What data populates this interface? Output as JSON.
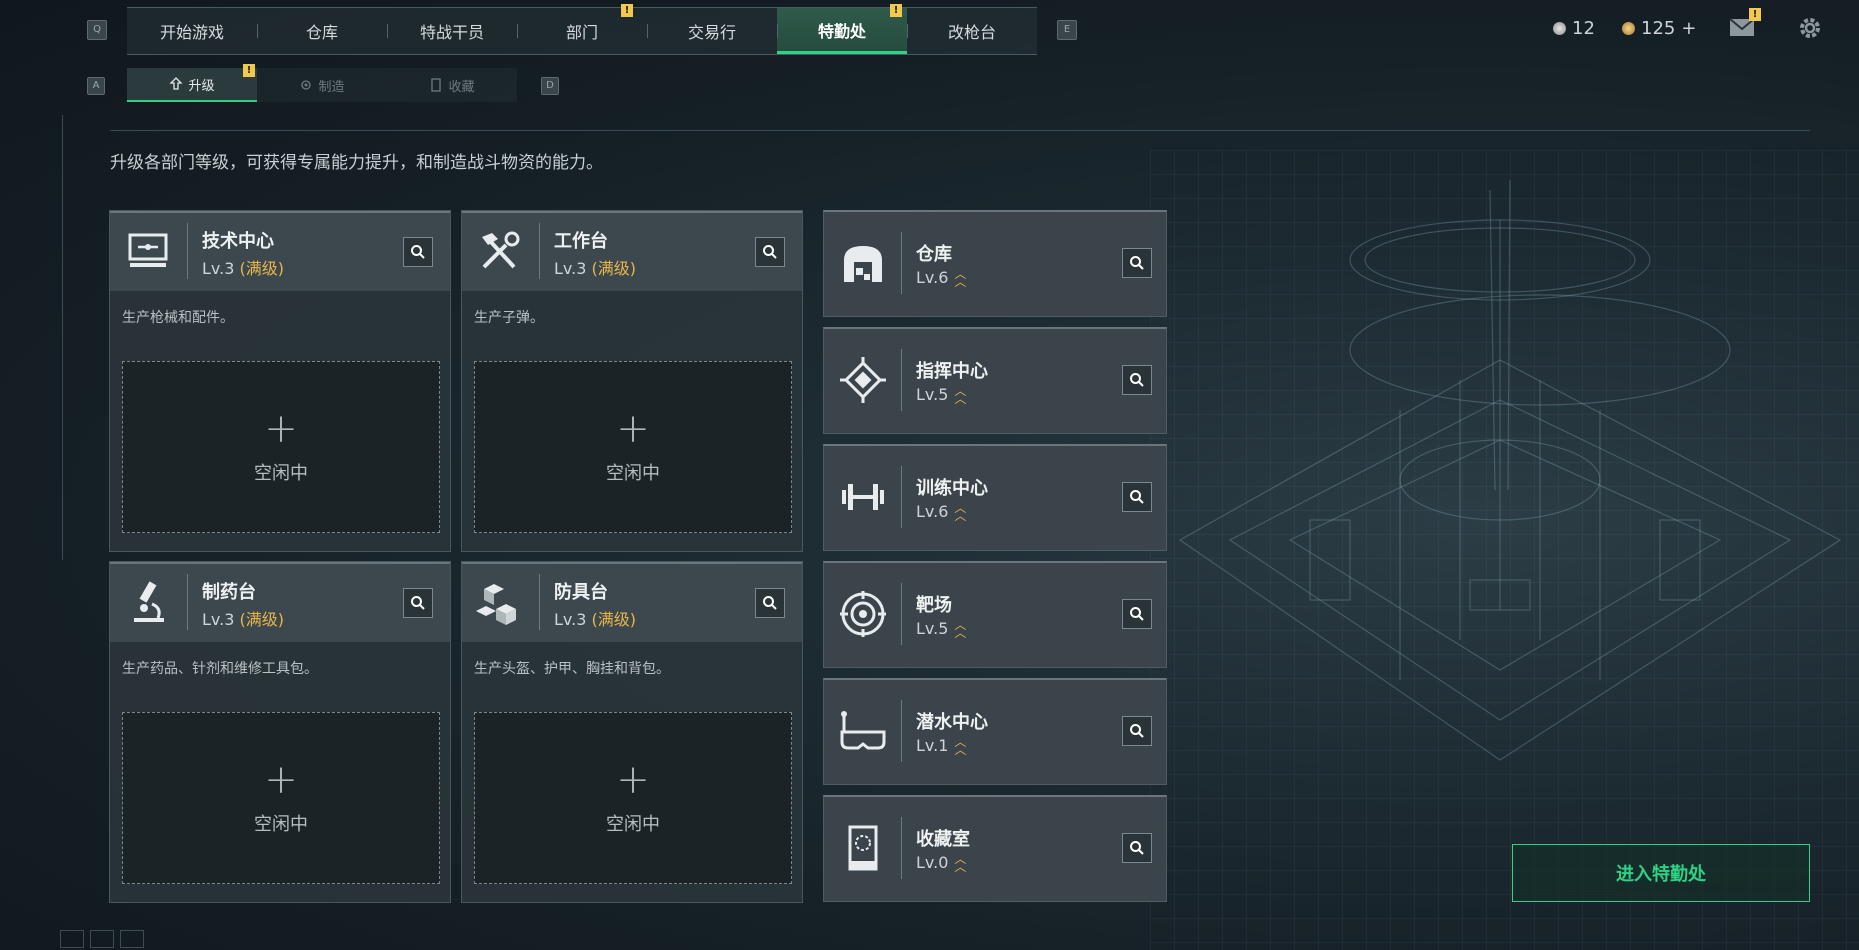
{
  "nav": {
    "key_left": "Q",
    "key_right": "E",
    "tabs": [
      {
        "label": "开始游戏",
        "badge": ""
      },
      {
        "label": "仓库",
        "badge": ""
      },
      {
        "label": "特战干员",
        "badge": ""
      },
      {
        "label": "部门",
        "badge": "!"
      },
      {
        "label": "交易行",
        "badge": ""
      },
      {
        "label": "特勤处",
        "badge": "!"
      },
      {
        "label": "改枪台",
        "badge": ""
      }
    ],
    "active_tab": "特勤处"
  },
  "subnav": {
    "key_left": "A",
    "key_right": "D",
    "tabs": [
      {
        "label": "升级",
        "badge": "!"
      },
      {
        "label": "制造",
        "badge": ""
      },
      {
        "label": "收藏",
        "badge": ""
      }
    ],
    "active_tab": "升级"
  },
  "resources": {
    "silver": "12",
    "gold": "125",
    "gold_add": "+",
    "mail_badge": "!"
  },
  "colors": {
    "accent": "#2fd184",
    "max_level": "#e8b54a",
    "badge": "#f2c94c"
  },
  "description": "升级各部门等级，可获得专属能力提升，和制造战斗物资的能力。",
  "workshops": [
    {
      "title": "技术中心",
      "level": "Lv.3",
      "max": "(满级)",
      "desc": "生产枪械和配件。",
      "slot_plus": "+",
      "slot_status": "空闲中",
      "icon": "monitor-icon"
    },
    {
      "title": "工作台",
      "level": "Lv.3",
      "max": "(满级)",
      "desc": "生产子弹。",
      "slot_plus": "+",
      "slot_status": "空闲中",
      "icon": "tools-icon"
    },
    {
      "title": "制药台",
      "level": "Lv.3",
      "max": "(满级)",
      "desc": "生产药品、针剂和维修工具包。",
      "slot_plus": "+",
      "slot_status": "空闲中",
      "icon": "microscope-icon"
    },
    {
      "title": "防具台",
      "level": "Lv.3",
      "max": "(满级)",
      "desc": "生产头盔、护甲、胸挂和背包。",
      "slot_plus": "+",
      "slot_status": "空闲中",
      "icon": "cubes-icon"
    }
  ],
  "departments": [
    {
      "title": "仓库",
      "level": "Lv.6",
      "icon": "warehouse-icon"
    },
    {
      "title": "指挥中心",
      "level": "Lv.5",
      "icon": "chip-icon"
    },
    {
      "title": "训练中心",
      "level": "Lv.6",
      "icon": "dumbbell-icon"
    },
    {
      "title": "靶场",
      "level": "Lv.5",
      "icon": "target-icon"
    },
    {
      "title": "潜水中心",
      "level": "Lv.1",
      "icon": "diving-mask-icon"
    },
    {
      "title": "收藏室",
      "level": "Lv.0",
      "icon": "display-case-icon"
    }
  ],
  "enter_button": "进入特勤处"
}
